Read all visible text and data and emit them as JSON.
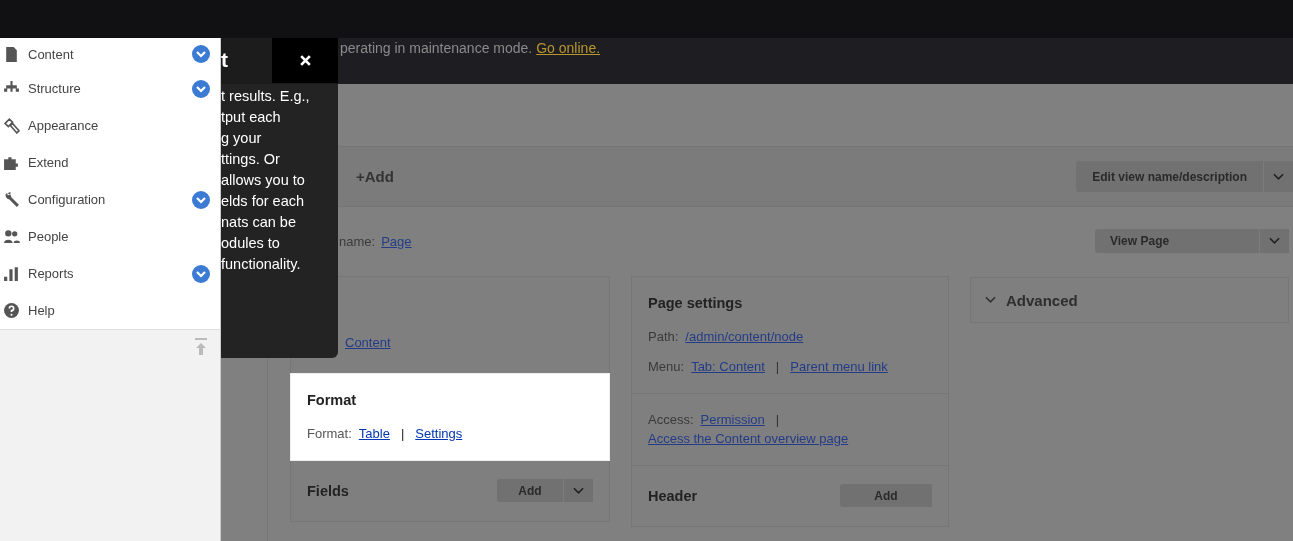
{
  "admin_menu": {
    "items": [
      {
        "label": "Content",
        "expandable": true
      },
      {
        "label": "Structure",
        "expandable": true
      },
      {
        "label": "Appearance",
        "expandable": false
      },
      {
        "label": "Extend",
        "expandable": false
      },
      {
        "label": "Configuration",
        "expandable": true
      },
      {
        "label": "People",
        "expandable": false
      },
      {
        "label": "Reports",
        "expandable": true
      },
      {
        "label": "Help",
        "expandable": false
      }
    ]
  },
  "tour_tip": {
    "title": "t",
    "body": "t results. E.g.,\ntput each\ng your\nttings. Or\nallows you to\nelds for each\nnats can be\nodules to\nfunctionality."
  },
  "maintenance": {
    "message": "perating in maintenance mode.",
    "link": "Go online."
  },
  "displays": {
    "add": "+Add",
    "edit_button": "Edit view name/description"
  },
  "display_name": {
    "label": "name:",
    "value": "Page",
    "view_button": "View Page"
  },
  "columns": [
    [
      {
        "rows": [
          {
            "links": [
              "Content"
            ]
          }
        ]
      },
      {
        "title": "Format",
        "highlighted": true,
        "rows": [
          {
            "label": "Format:",
            "links": [
              "Table",
              "Settings"
            ],
            "separator": "|"
          }
        ]
      },
      {
        "title": "Fields",
        "button": "Add",
        "dropdown": true
      }
    ],
    [
      {
        "title": "Page settings",
        "rows": [
          {
            "label": "Path:",
            "links": [
              "/admin/content/node"
            ]
          },
          {
            "label": "Menu:",
            "links": [
              "Tab: Content",
              "Parent menu link"
            ],
            "separator": "|"
          }
        ]
      },
      {
        "rows": [
          {
            "label": "Access:",
            "links": [
              "Permission",
              "Access the Content overview page"
            ],
            "separator": "|"
          }
        ]
      },
      {
        "title": "Header",
        "button": "Add",
        "dropdown": false
      }
    ],
    [
      {
        "title": "Advanced",
        "kind": "collapsible",
        "expanded": false
      }
    ]
  ]
}
